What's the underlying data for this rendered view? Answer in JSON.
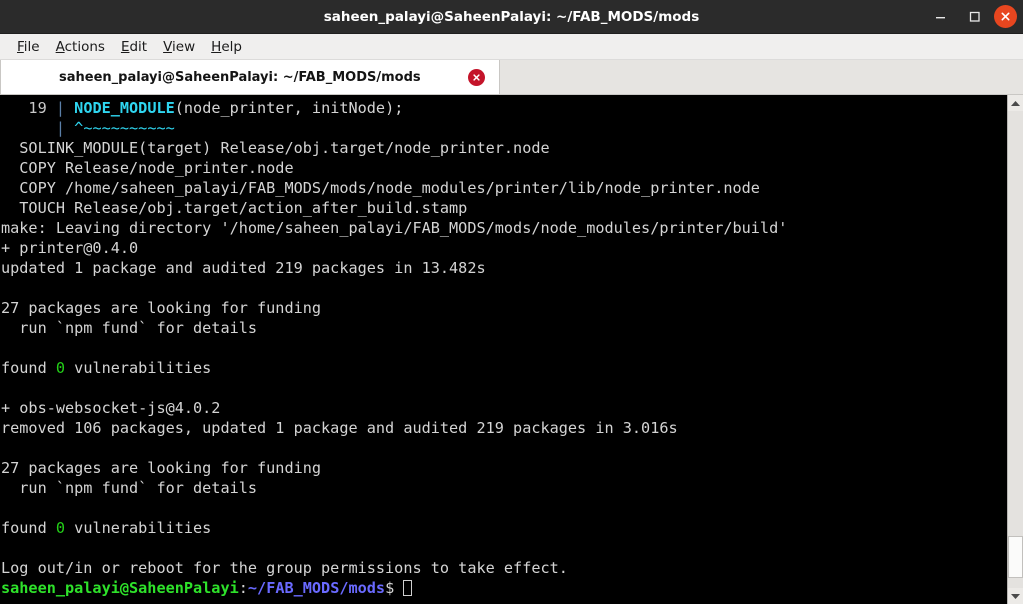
{
  "window": {
    "title": "saheen_palayi@SaheenPalayi: ~/FAB_MODS/mods",
    "controls": {
      "minimize": "minimize",
      "maximize": "maximize",
      "close": "close"
    },
    "accent_close": "#e8461f",
    "accent_tab_close": "#c4142a"
  },
  "menubar": {
    "items": [
      {
        "mnemonic": "F",
        "rest": "ile"
      },
      {
        "mnemonic": "A",
        "rest": "ctions"
      },
      {
        "mnemonic": "E",
        "rest": "dit"
      },
      {
        "mnemonic": "V",
        "rest": "iew"
      },
      {
        "mnemonic": "H",
        "rest": "elp"
      }
    ]
  },
  "tabs": [
    {
      "label": "saheen_palayi@SaheenPalayi: ~/FAB_MODS/mods",
      "active": true,
      "close": "close-tab"
    }
  ],
  "terminal": {
    "background": "#000000",
    "foreground": "#d4d4d4",
    "lines": [
      {
        "segments": [
          {
            "t": "   19 ",
            "c": "c-dim"
          },
          {
            "t": "| ",
            "c": "c-bluebar"
          },
          {
            "t": "NODE_MODULE",
            "c": "c-cyan"
          },
          {
            "t": "(node_printer, initNode);",
            "c": "c-default"
          }
        ]
      },
      {
        "segments": [
          {
            "t": "      ",
            "c": "c-default"
          },
          {
            "t": "| ",
            "c": "c-bluebar"
          },
          {
            "t": "^~~~~~~~~~~",
            "c": "c-cyan-p"
          }
        ]
      },
      {
        "segments": [
          {
            "t": "  SOLINK_MODULE(target) Release/obj.target/node_printer.node",
            "c": "c-default"
          }
        ]
      },
      {
        "segments": [
          {
            "t": "  COPY Release/node_printer.node",
            "c": "c-default"
          }
        ]
      },
      {
        "segments": [
          {
            "t": "  COPY /home/saheen_palayi/FAB_MODS/mods/node_modules/printer/lib/node_printer.node",
            "c": "c-default"
          }
        ]
      },
      {
        "segments": [
          {
            "t": "  TOUCH Release/obj.target/action_after_build.stamp",
            "c": "c-default"
          }
        ]
      },
      {
        "segments": [
          {
            "t": "make: Leaving directory '/home/saheen_palayi/FAB_MODS/mods/node_modules/printer/build'",
            "c": "c-default"
          }
        ]
      },
      {
        "segments": [
          {
            "t": "+ printer@0.4.0",
            "c": "c-default"
          }
        ]
      },
      {
        "segments": [
          {
            "t": "updated 1 package and audited 219 packages in 13.482s",
            "c": "c-default"
          }
        ]
      },
      {
        "segments": [
          {
            "t": "",
            "c": "c-default"
          }
        ]
      },
      {
        "segments": [
          {
            "t": "27 packages are looking for funding",
            "c": "c-default"
          }
        ]
      },
      {
        "segments": [
          {
            "t": "  run `npm fund` for details",
            "c": "c-default"
          }
        ]
      },
      {
        "segments": [
          {
            "t": "",
            "c": "c-default"
          }
        ]
      },
      {
        "segments": [
          {
            "t": "found ",
            "c": "c-default"
          },
          {
            "t": "0",
            "c": "c-green"
          },
          {
            "t": " vulnerabilities",
            "c": "c-default"
          }
        ]
      },
      {
        "segments": [
          {
            "t": "",
            "c": "c-default"
          }
        ]
      },
      {
        "segments": [
          {
            "t": "+ obs-websocket-js@4.0.2",
            "c": "c-default"
          }
        ]
      },
      {
        "segments": [
          {
            "t": "removed 106 packages, updated 1 package and audited 219 packages in 3.016s",
            "c": "c-default"
          }
        ]
      },
      {
        "segments": [
          {
            "t": "",
            "c": "c-default"
          }
        ]
      },
      {
        "segments": [
          {
            "t": "27 packages are looking for funding",
            "c": "c-default"
          }
        ]
      },
      {
        "segments": [
          {
            "t": "  run `npm fund` for details",
            "c": "c-default"
          }
        ]
      },
      {
        "segments": [
          {
            "t": "",
            "c": "c-default"
          }
        ]
      },
      {
        "segments": [
          {
            "t": "found ",
            "c": "c-default"
          },
          {
            "t": "0",
            "c": "c-green"
          },
          {
            "t": " vulnerabilities",
            "c": "c-default"
          }
        ]
      },
      {
        "segments": [
          {
            "t": "",
            "c": "c-default"
          }
        ]
      },
      {
        "segments": [
          {
            "t": "Log out/in or reboot for the group permissions to take effect.",
            "c": "c-default"
          }
        ]
      },
      {
        "segments": [
          {
            "t": "saheen_palayi@SaheenPalayi",
            "c": "c-greenb"
          },
          {
            "t": ":",
            "c": "c-default"
          },
          {
            "t": "~/FAB_MODS/mods",
            "c": "c-blueb"
          },
          {
            "t": "$ ",
            "c": "c-default"
          },
          {
            "t": "",
            "c": "cursor"
          }
        ]
      }
    ]
  },
  "scrollbar": {
    "up_arrow": "scroll-up",
    "down_arrow": "scroll-down",
    "thumb_top_pct": 89,
    "thumb_height_pct": 9
  }
}
